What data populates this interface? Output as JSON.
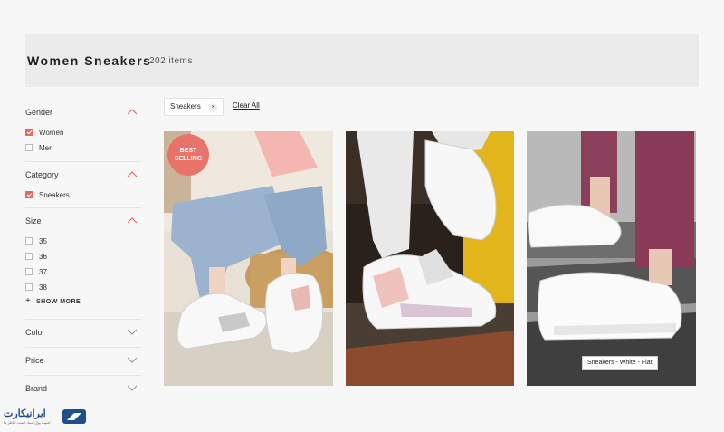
{
  "header": {
    "title": "Women Sneakers",
    "count": "202 items"
  },
  "filters": {
    "gender": {
      "label": "Gender",
      "options": [
        {
          "label": "Women",
          "checked": true
        },
        {
          "label": "Men",
          "checked": false
        }
      ]
    },
    "category": {
      "label": "Category",
      "options": [
        {
          "label": "Sneakers",
          "checked": true
        }
      ]
    },
    "size": {
      "label": "Size",
      "options": [
        {
          "label": "35"
        },
        {
          "label": "36"
        },
        {
          "label": "37"
        },
        {
          "label": "38"
        }
      ],
      "show_more": "SHOW MORE"
    },
    "color": {
      "label": "Color"
    },
    "price": {
      "label": "Price"
    },
    "brand": {
      "label": "Brand"
    }
  },
  "active_filters": {
    "chip": "Sneakers",
    "chip_remove": "×",
    "clear_all": "Clear All"
  },
  "products": [
    {
      "badge_line1": "BEST",
      "badge_line2": "SELLING"
    },
    {},
    {
      "tooltip": "Sneakers - White - Flat"
    }
  ],
  "footer_logo": {
    "text": "ایرانیکارت",
    "subtext": "امنیت پول شما، امنیت خاطر ما"
  },
  "colors": {
    "accent": "#e26a5f",
    "banner_bg": "#ebebeb",
    "badge": "#e8736a"
  }
}
